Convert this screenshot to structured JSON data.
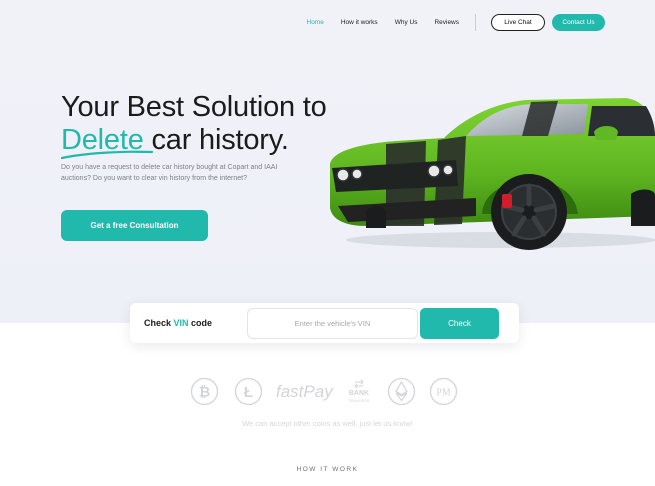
{
  "nav": {
    "links": [
      "Home",
      "How it works",
      "Why Us",
      "Reviews"
    ],
    "active": "Home",
    "live_chat": "Live Chat",
    "contact": "Contact Us"
  },
  "hero": {
    "headline_line1": "Your Best Solution to",
    "headline_accent": "Delete",
    "headline_rest": " car history.",
    "subtext": "Do you have a request to delete car history bought at Copart and IAAI auctions? Do you want to clear vin history from the internet?",
    "cta": "Get a free Consultation"
  },
  "vin": {
    "label_prefix": "Check ",
    "label_accent": "VIN",
    "label_suffix": " code",
    "placeholder": "Enter the vehicle's VIN",
    "button": "Check"
  },
  "payments": {
    "icons": [
      "bitcoin-icon",
      "litecoin-icon",
      "fastpay-logo",
      "bank-transfer-icon",
      "ethereum-icon",
      "perfect-money-icon"
    ],
    "fastpay_text": "fastPay",
    "bank_text": "BANK",
    "bank_subtext": "TRANSFER",
    "pm_text": "PM",
    "note": "We can accept other coins as well, just let us know!"
  },
  "section": {
    "how_title": "HOW IT WORK"
  },
  "colors": {
    "accent": "#22b9ad",
    "car_green": "#6cc62a",
    "muted_icon": "#d2d4da"
  }
}
